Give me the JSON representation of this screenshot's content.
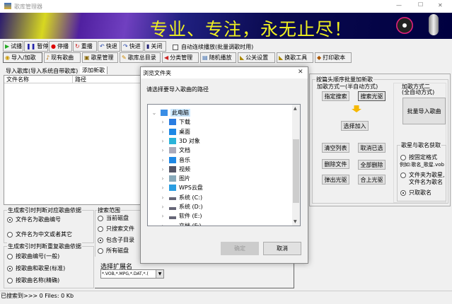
{
  "window": {
    "title": "歌库管理器",
    "minimize": "—",
    "maximize": "☐",
    "close": "✕"
  },
  "banner": {
    "slogan": "专业、专注，永无止尽！"
  },
  "toolbar1": {
    "items": [
      {
        "icon": "play-icon",
        "label": "试播"
      },
      {
        "icon": "pause-icon",
        "label": "暂停"
      },
      {
        "icon": "stop-icon",
        "label": "停播"
      },
      {
        "icon": "replay-icon",
        "label": "重播"
      },
      {
        "icon": "rewind-icon",
        "label": "快退"
      },
      {
        "icon": "forward-icon",
        "label": "快进"
      },
      {
        "icon": "close-icon",
        "label": "关闭"
      }
    ],
    "auto_play": "自动连续播放(批量调歌时用)"
  },
  "toolbar2": {
    "items": [
      {
        "icon": "disc-icon",
        "label": "导入/加歌"
      },
      {
        "icon": "song-icon",
        "label": "现有歌曲"
      },
      {
        "icon": "singer-icon",
        "label": "歌星管理"
      },
      {
        "icon": "catalog-icon",
        "label": "歌库总目录"
      },
      {
        "icon": "category-icon",
        "label": "分类管理"
      },
      {
        "icon": "random-icon",
        "label": "随机播放"
      },
      {
        "icon": "settings-icon",
        "label": "公关设置"
      },
      {
        "icon": "tools-icon",
        "label": "换歌工具"
      },
      {
        "icon": "print-icon",
        "label": "打印歌本"
      }
    ]
  },
  "tabs": [
    {
      "label": "导入歌库(导入系统自带歌库)"
    },
    {
      "label": "添加新歌"
    }
  ],
  "file_list": {
    "columns": [
      "文件名称",
      "路径"
    ]
  },
  "index_group": {
    "title": "生成索引时判断对应歌曲依据",
    "options": [
      "文件名为歌曲编号",
      "文件名为中文或者其它"
    ],
    "selected": 0
  },
  "dup_group": {
    "title": "生成索引时判断重复歌曲依据",
    "options": [
      "按歌曲编号(一般)",
      "按歌曲和歌星(标准)",
      "按歌曲名称(精确)"
    ],
    "selected": 1
  },
  "search_group": {
    "title": "搜索范围",
    "options": [
      "当前磁盘",
      "只搜索文件",
      "包含子目录",
      "所有磁盘"
    ],
    "selected": 2
  },
  "ext": {
    "label": "选择扩展名",
    "value": "*.VOB,*.MPG,*.DAT,*.("
  },
  "right": {
    "group_title": "按篇头顺序批量加新歌",
    "method1": "加歌方式一(半自动方式)",
    "btn_search": "指定搜索",
    "btn_search_cd": "搜索光驱",
    "btn_add": "选择加入",
    "btn_clear": "清空列表",
    "btn_unselect": "取消已选",
    "btn_delete": "删除文件",
    "btn_delete_all": "全部删除",
    "btn_eject": "弹出光驱",
    "btn_close_cd": "合上光驱",
    "method2_l1": "加歌方式二",
    "method2_l2": "(全自动方式)",
    "btn_batch": "批量导入歌曲",
    "name_group": {
      "title": "歌星与歌名获取",
      "options": [
        "按固定格式",
        "文件夹为歌星,",
        "只取歌名"
      ],
      "example": "例如:歌名_歌星.vob",
      "opt2_line2": "文件名为歌名",
      "selected": 2
    }
  },
  "status": {
    "text": "已搜索到>>> 0 Files: 0 Kb"
  },
  "dialog": {
    "title": "浏览文件夹",
    "prompt": "请选择要导入歌曲的路径",
    "tree": [
      {
        "label": "此电脑",
        "icon": "computer-icon",
        "expanded": true
      },
      {
        "label": "下载",
        "icon": "download-icon"
      },
      {
        "label": "桌面",
        "icon": "desktop-icon"
      },
      {
        "label": "3D 对象",
        "icon": "3d-icon"
      },
      {
        "label": "文档",
        "icon": "document-icon"
      },
      {
        "label": "音乐",
        "icon": "music-icon"
      },
      {
        "label": "视频",
        "icon": "video-icon"
      },
      {
        "label": "图片",
        "icon": "picture-icon"
      },
      {
        "label": "WPS云盘",
        "icon": "cloud-icon"
      },
      {
        "label": "系统 (C:)",
        "icon": "drive-icon"
      },
      {
        "label": "系统 (D:)",
        "icon": "drive-icon"
      },
      {
        "label": "软件 (E:)",
        "icon": "drive-icon"
      },
      {
        "label": "文档 (F:)",
        "icon": "drive-icon"
      }
    ],
    "ok": "确定",
    "cancel": "取消",
    "close": "✕"
  }
}
